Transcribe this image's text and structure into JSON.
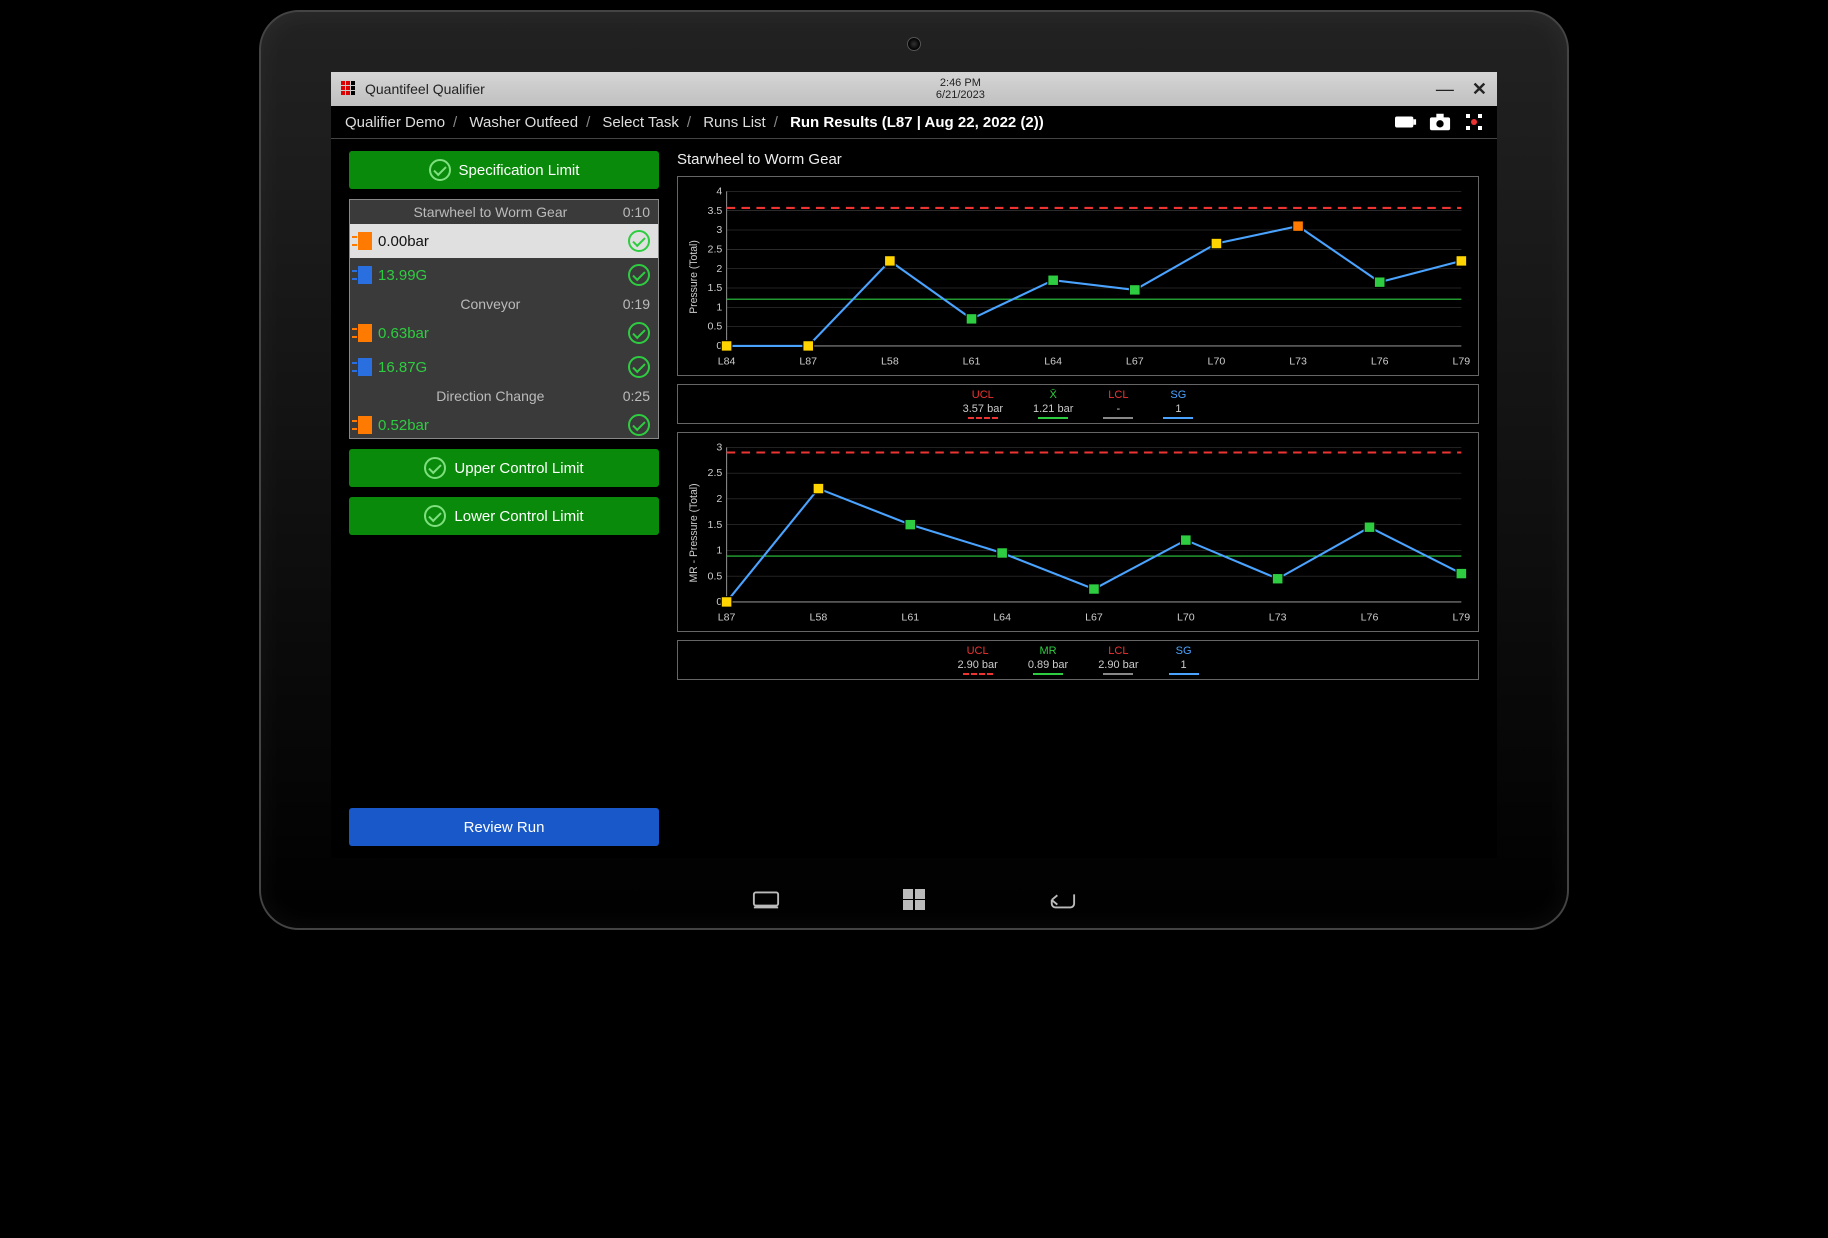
{
  "titlebar": {
    "app_name": "Quantifeel Qualifier",
    "time": "2:46 PM",
    "date": "6/21/2023"
  },
  "breadcrumbs": [
    "Qualifier Demo",
    "Washer Outfeed",
    "Select Task",
    "Runs List",
    "Run Results (L87 | Aug 22, 2022 (2))"
  ],
  "sidebar": {
    "spec_limit_label": "Specification Limit",
    "ucl_label": "Upper Control Limit",
    "lcl_label": "Lower Control Limit",
    "review_label": "Review Run",
    "groups": [
      {
        "title": "Starwheel to Worm Gear",
        "time": "0:10",
        "items": [
          {
            "icon": "orange",
            "value": "0.00bar",
            "active": true
          },
          {
            "icon": "blue",
            "value": "13.99G",
            "active": false
          }
        ]
      },
      {
        "title": "Conveyor",
        "time": "0:19",
        "items": [
          {
            "icon": "orange",
            "value": "0.63bar",
            "active": false
          },
          {
            "icon": "blue",
            "value": "16.87G",
            "active": false
          }
        ]
      },
      {
        "title": "Direction Change",
        "time": "0:25",
        "items": [
          {
            "icon": "orange",
            "value": "0.52bar",
            "active": false
          }
        ]
      }
    ]
  },
  "chart_data": [
    {
      "type": "line",
      "title": "Starwheel to Worm Gear",
      "ylabel": "Pressure (Total)",
      "categories": [
        "L84",
        "L87",
        "L58",
        "L61",
        "L64",
        "L67",
        "L70",
        "L73",
        "L76",
        "L79"
      ],
      "series": [
        {
          "name": "Pressure",
          "values": [
            0.0,
            0.0,
            2.2,
            0.7,
            1.7,
            1.45,
            2.65,
            3.1,
            1.65,
            2.2
          ],
          "point_status": [
            "yellow",
            "yellow",
            "yellow",
            "green",
            "green",
            "green",
            "yellow",
            "orange",
            "green",
            "yellow"
          ]
        }
      ],
      "ucl": 3.57,
      "mean": 1.21,
      "lcl": null,
      "sg": 1,
      "ylim": [
        0,
        4
      ],
      "ytick": 0.5,
      "legend": [
        {
          "name": "UCL",
          "value": "3.57 bar",
          "color": "red",
          "style": "dashed"
        },
        {
          "name": "X̄",
          "value": "1.21 bar",
          "color": "green",
          "style": "solid"
        },
        {
          "name": "LCL",
          "value": "-",
          "color": "red",
          "style": "grey"
        },
        {
          "name": "SG",
          "value": "1",
          "color": "blue",
          "style": "solid"
        }
      ]
    },
    {
      "type": "line",
      "title": "",
      "ylabel": "MR - Pressure (Total)",
      "categories": [
        "L87",
        "L58",
        "L61",
        "L64",
        "L67",
        "L70",
        "L73",
        "L76",
        "L79"
      ],
      "series": [
        {
          "name": "MR",
          "values": [
            0.0,
            2.2,
            1.5,
            0.95,
            0.25,
            1.2,
            0.45,
            1.45,
            0.55
          ],
          "point_status": [
            "yellow",
            "yellow",
            "green",
            "green",
            "green",
            "green",
            "green",
            "green",
            "green"
          ]
        }
      ],
      "ucl": 2.9,
      "mean": 0.89,
      "lcl": 2.9,
      "sg": 1,
      "ylim": [
        0,
        3
      ],
      "ytick": 0.5,
      "legend": [
        {
          "name": "UCL",
          "value": "2.90 bar",
          "color": "red",
          "style": "dashed"
        },
        {
          "name": "MR",
          "value": "0.89 bar",
          "color": "green",
          "style": "solid"
        },
        {
          "name": "LCL",
          "value": "2.90 bar",
          "color": "red",
          "style": "grey"
        },
        {
          "name": "SG",
          "value": "1",
          "color": "blue",
          "style": "solid"
        }
      ]
    }
  ]
}
